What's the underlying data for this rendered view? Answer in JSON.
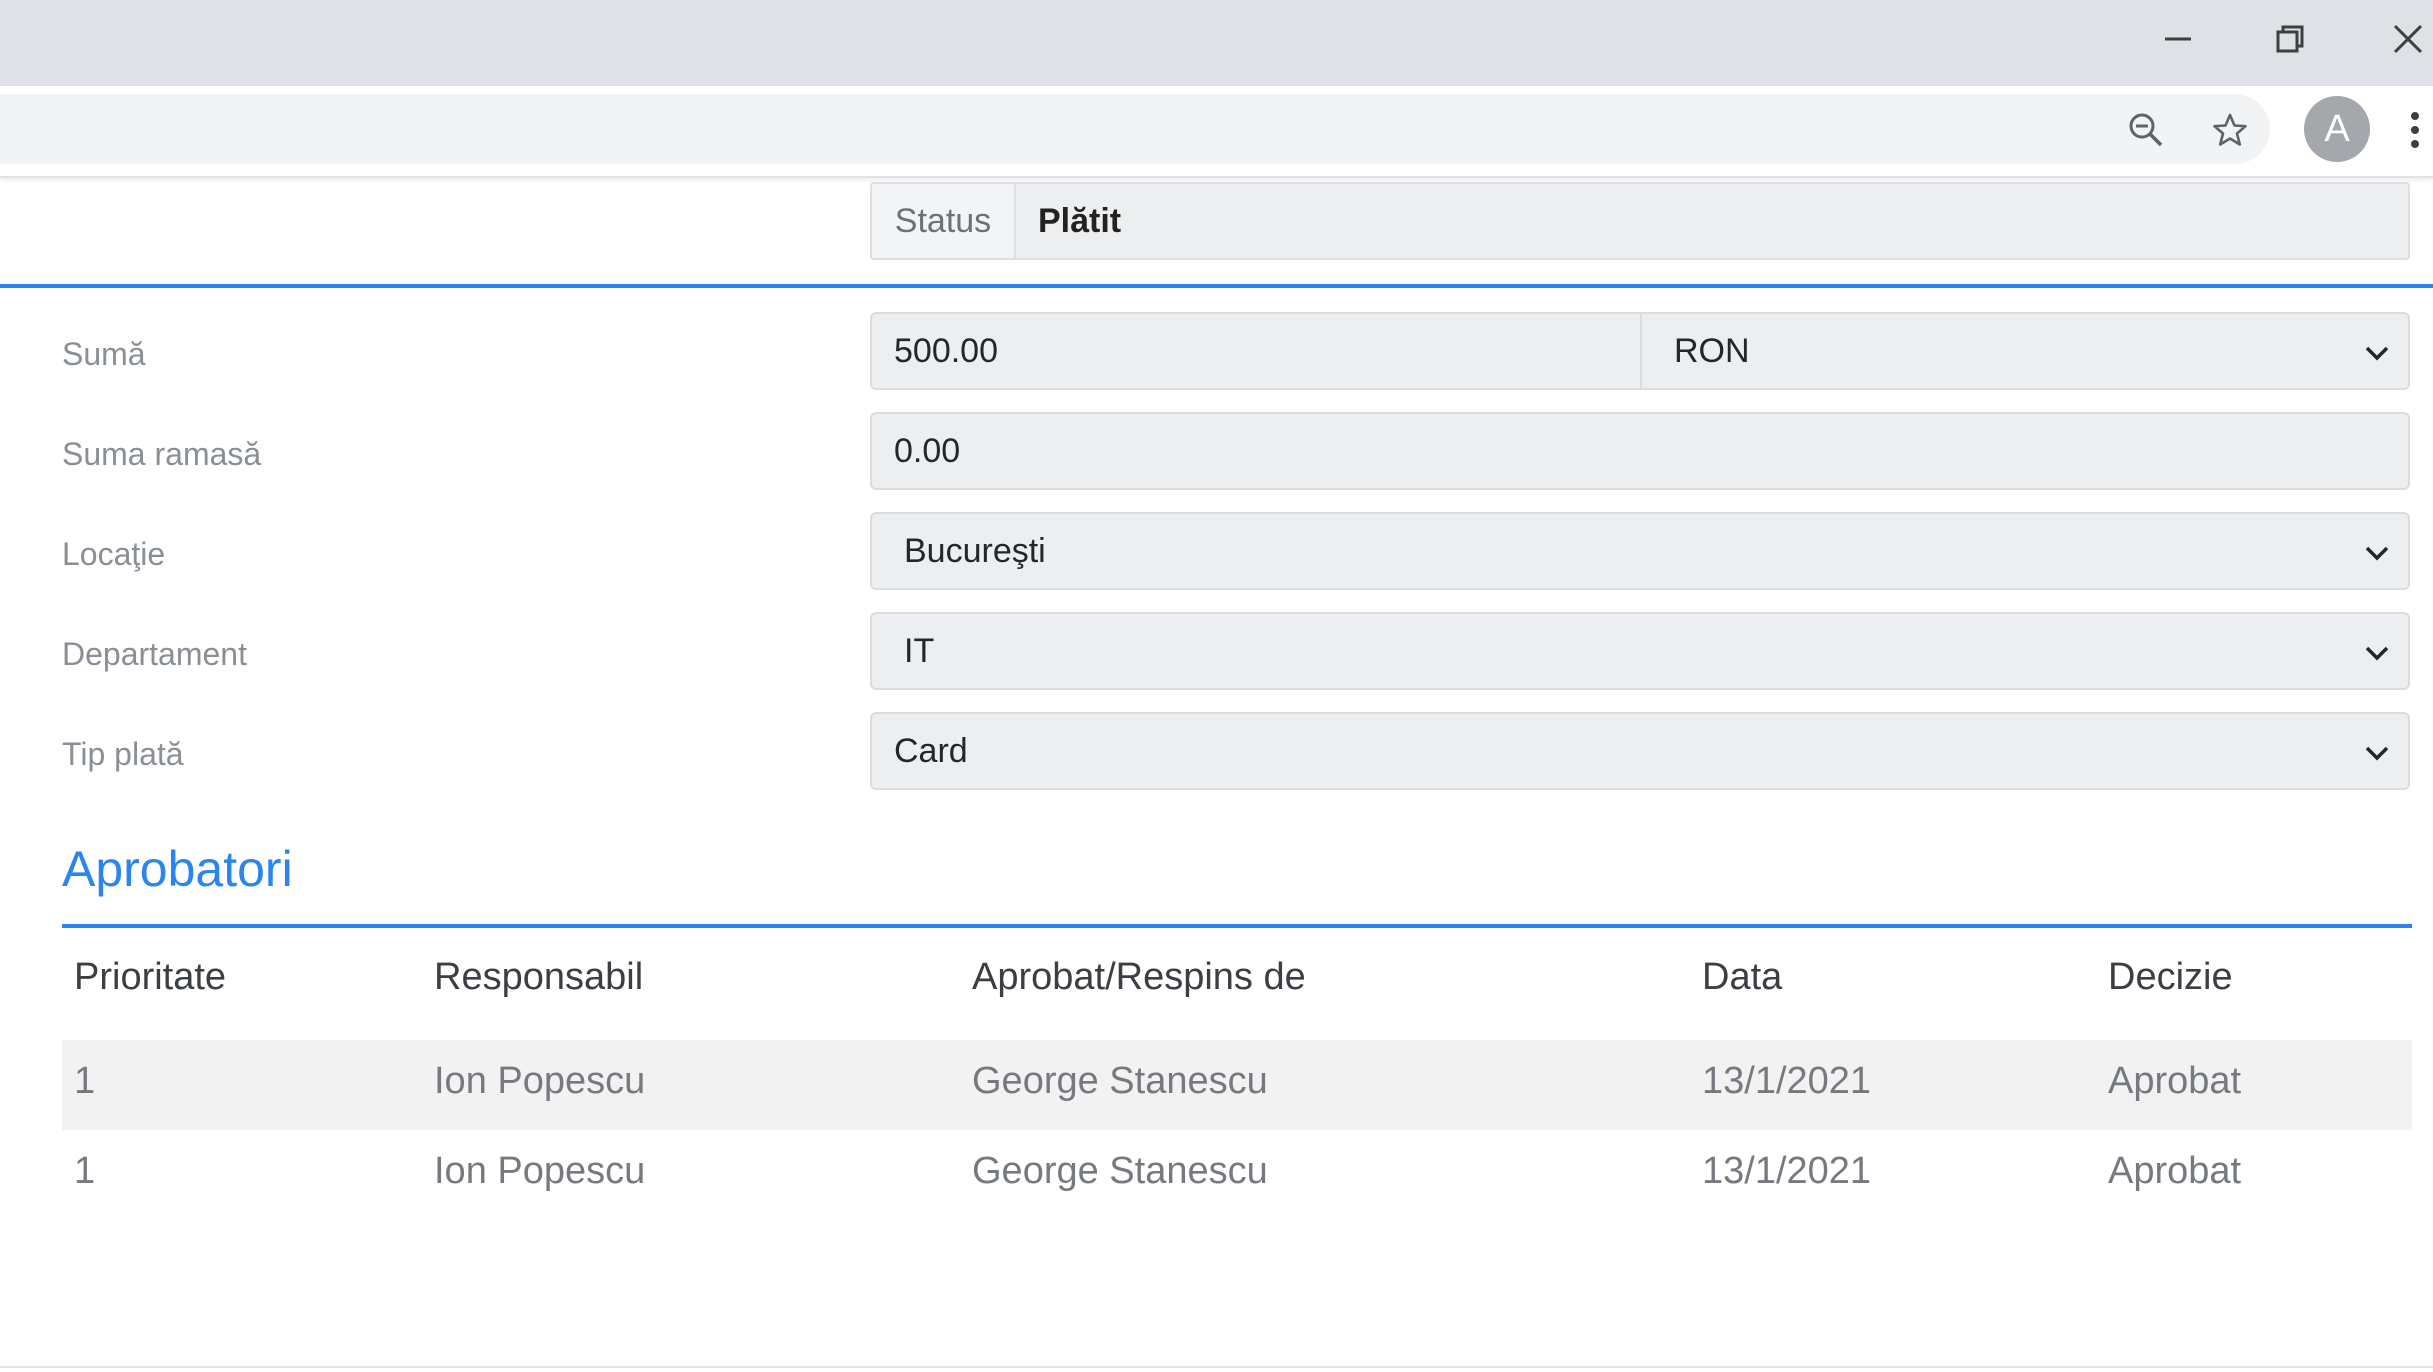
{
  "window": {
    "minimize_icon": "minimize-icon",
    "restore_icon": "restore-icon",
    "close_icon": "close-icon"
  },
  "toolbar": {
    "zoom_icon": "zoom-icon",
    "bookmark_icon": "star-icon",
    "profile_initial": "A",
    "menu_icon": "kebab-menu-icon"
  },
  "status": {
    "label": "Status",
    "value": "Plătit"
  },
  "form": {
    "suma": {
      "label": "Sumă",
      "value": "500.00",
      "currency": "RON"
    },
    "suma_ramasa": {
      "label": "Suma ramasă",
      "value": "0.00"
    },
    "locatie": {
      "label": "Locaţie",
      "value": "Bucureşti"
    },
    "departament": {
      "label": "Departament",
      "value": "IT"
    },
    "tip_plata": {
      "label": "Tip plată",
      "value": "Card"
    }
  },
  "approvers": {
    "title": "Aprobatori",
    "columns": [
      "Prioritate",
      "Responsabil",
      "Aprobat/Respins de",
      "Data",
      "Decizie"
    ],
    "rows": [
      [
        "1",
        "Ion Popescu",
        "George Stanescu",
        "13/1/2021",
        "Aprobat"
      ],
      [
        "1",
        "Ion Popescu",
        "George Stanescu",
        "13/1/2021",
        "Aprobat"
      ]
    ]
  },
  "colors": {
    "accent": "#2a85ee",
    "chrome_bg": "#dee1e6",
    "field_bg": "#eceef0"
  }
}
